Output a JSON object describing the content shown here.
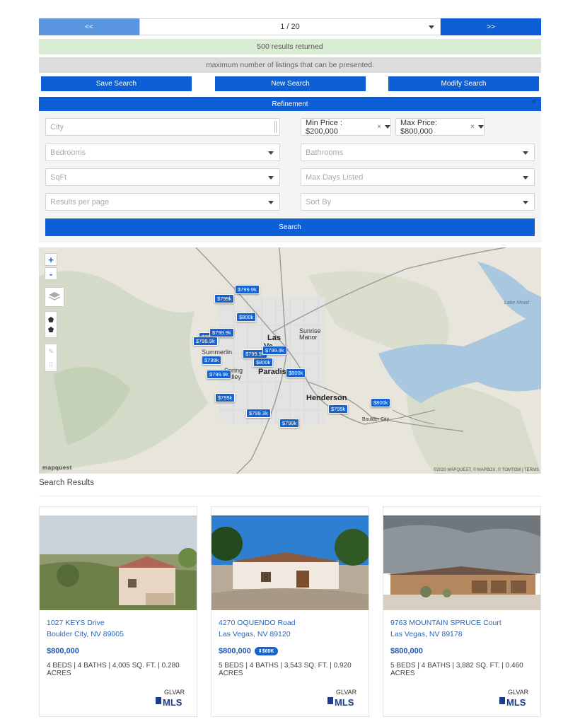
{
  "pager": {
    "prev_label": "<<",
    "page_value": "1 / 20",
    "next_label": ">>"
  },
  "notices": {
    "results": "500 results returned",
    "maximum": "maximum number of listings that can be presented."
  },
  "actions": {
    "save": "Save Search",
    "new": "New Search",
    "modify": "Modify Search"
  },
  "refinement": {
    "title": "Refinement",
    "city_placeholder": "City",
    "min_price": "Min Price : $200,000",
    "max_price": "Max Price: $800,000",
    "clear_symbol": "×",
    "bedrooms": "Bedrooms",
    "bathrooms": "Bathrooms",
    "sqft": "SqFt",
    "max_days": "Max Days Listed",
    "results_per_page": "Results per page",
    "sort_by": "Sort By",
    "search_label": "Search"
  },
  "map": {
    "zoom_in": "+",
    "zoom_out": "-",
    "logo": "mapquest",
    "attribution": "©2020 MAPQUEST, © MAPBOX, © TOMTOM | TERMS",
    "labels": {
      "las": "Las",
      "vegas_short": "Ve",
      "paradise": "Paradise",
      "henderson": "Henderson",
      "sunrise_manor": "Sunrise Manor",
      "summerlin": "Summerlin",
      "spring_valley": "Spring Valley",
      "boulder_city": "Boulder City",
      "lake_mead": "Lake Mead"
    },
    "pins": [
      "$799.9k",
      "$799k",
      "$800k",
      "$799k",
      "$799.9k",
      "$799.9k",
      "$799k",
      "$799.9k",
      "$799.9k",
      "$800k",
      "$800k",
      "$799.9k",
      "$799k",
      "$799.3k",
      "$799k",
      "$799k",
      "$800k"
    ],
    "icons": [
      "layers-icon",
      "polygon-icon",
      "pentagon-icon",
      "edit-icon",
      "trash-icon"
    ]
  },
  "results": {
    "title": "Search Results",
    "listings": [
      {
        "address1": "1027 KEYS Drive",
        "address2": "Boulder City, NV 89005",
        "price": "$800,000",
        "badge": "",
        "specs": "4 BEDS | 4 BATHS | 4,005 SQ. FT. | 0.280 ACRES",
        "logo_text": "GLVAR MLS"
      },
      {
        "address1": "4270 OQUENDO Road",
        "address2": "Las Vegas, NV 89120",
        "price": "$800,000",
        "badge": "⬇$60K",
        "specs": "5 BEDS | 4 BATHS | 3,543 SQ. FT. | 0.920 ACRES",
        "logo_text": "GLVAR MLS"
      },
      {
        "address1": "9763 MOUNTAIN SPRUCE Court",
        "address2": "Las Vegas, NV 89178",
        "price": "$800,000",
        "badge": "",
        "specs": "5 BEDS | 4 BATHS | 3,882 SQ. FT. | 0.460 ACRES",
        "logo_text": "GLVAR MLS"
      }
    ]
  }
}
